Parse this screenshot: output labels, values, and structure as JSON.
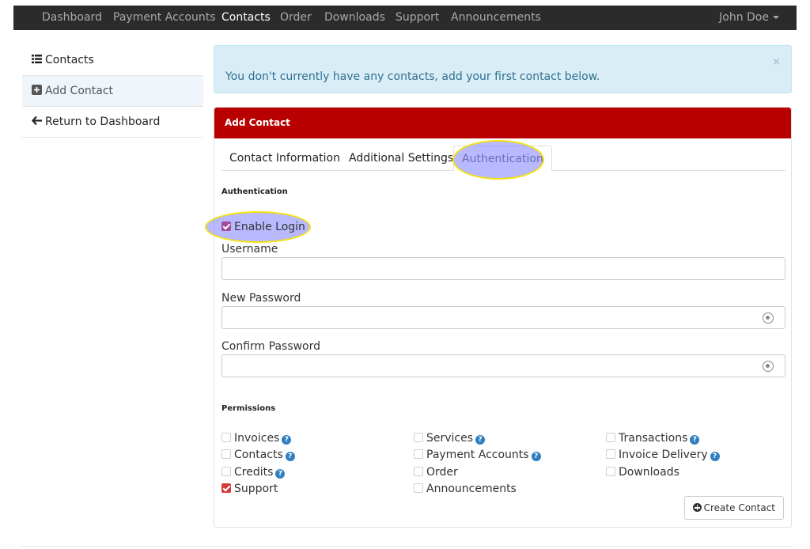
{
  "nav": {
    "items": [
      "Dashboard",
      "Payment Accounts",
      "Contacts",
      "Order",
      "Downloads",
      "Support",
      "Announcements"
    ],
    "active": "Contacts",
    "user": "John Doe"
  },
  "sidebar": {
    "items": [
      {
        "label": "Contacts",
        "icon": "list-icon"
      },
      {
        "label": "Add Contact",
        "icon": "plus-square-icon"
      },
      {
        "label": "Return to Dashboard",
        "icon": "arrow-left-icon"
      }
    ],
    "active": "Add Contact"
  },
  "alert": {
    "text": "You don't currently have any contacts, add your first contact below.",
    "close": "×"
  },
  "panel": {
    "title": "Add Contact",
    "tabs": [
      "Contact Information",
      "Additional Settings",
      "Authentication"
    ],
    "active_tab": "Authentication"
  },
  "auth": {
    "section_title": "Authentication",
    "enable_login_label": "Enable Login",
    "enable_login_checked": true,
    "username_label": "Username",
    "username_value": "",
    "new_password_label": "New Password",
    "new_password_value": "",
    "confirm_password_label": "Confirm Password",
    "confirm_password_value": ""
  },
  "permissions": {
    "section_title": "Permissions",
    "items": [
      {
        "label": "Invoices",
        "help": true,
        "checked": false
      },
      {
        "label": "Services",
        "help": true,
        "checked": false
      },
      {
        "label": "Transactions",
        "help": true,
        "checked": false
      },
      {
        "label": "Contacts",
        "help": true,
        "checked": false
      },
      {
        "label": "Payment Accounts",
        "help": true,
        "checked": false
      },
      {
        "label": "Invoice Delivery",
        "help": true,
        "checked": false
      },
      {
        "label": "Credits",
        "help": true,
        "checked": false
      },
      {
        "label": "Order",
        "help": false,
        "checked": false
      },
      {
        "label": "Downloads",
        "help": false,
        "checked": false
      },
      {
        "label": "Support",
        "help": false,
        "checked": true
      },
      {
        "label": "Announcements",
        "help": false,
        "checked": false
      }
    ],
    "help_glyph": "?"
  },
  "create_button": "Create Contact",
  "colors": {
    "navbar": "#2b2b2b",
    "panel_header": "#b80000",
    "alert_bg": "#d9edf7",
    "alert_text": "#31708f",
    "checkbox_checked": "#d33a3a",
    "help_icon": "#2f7fc1",
    "highlight": "#8080ff"
  }
}
